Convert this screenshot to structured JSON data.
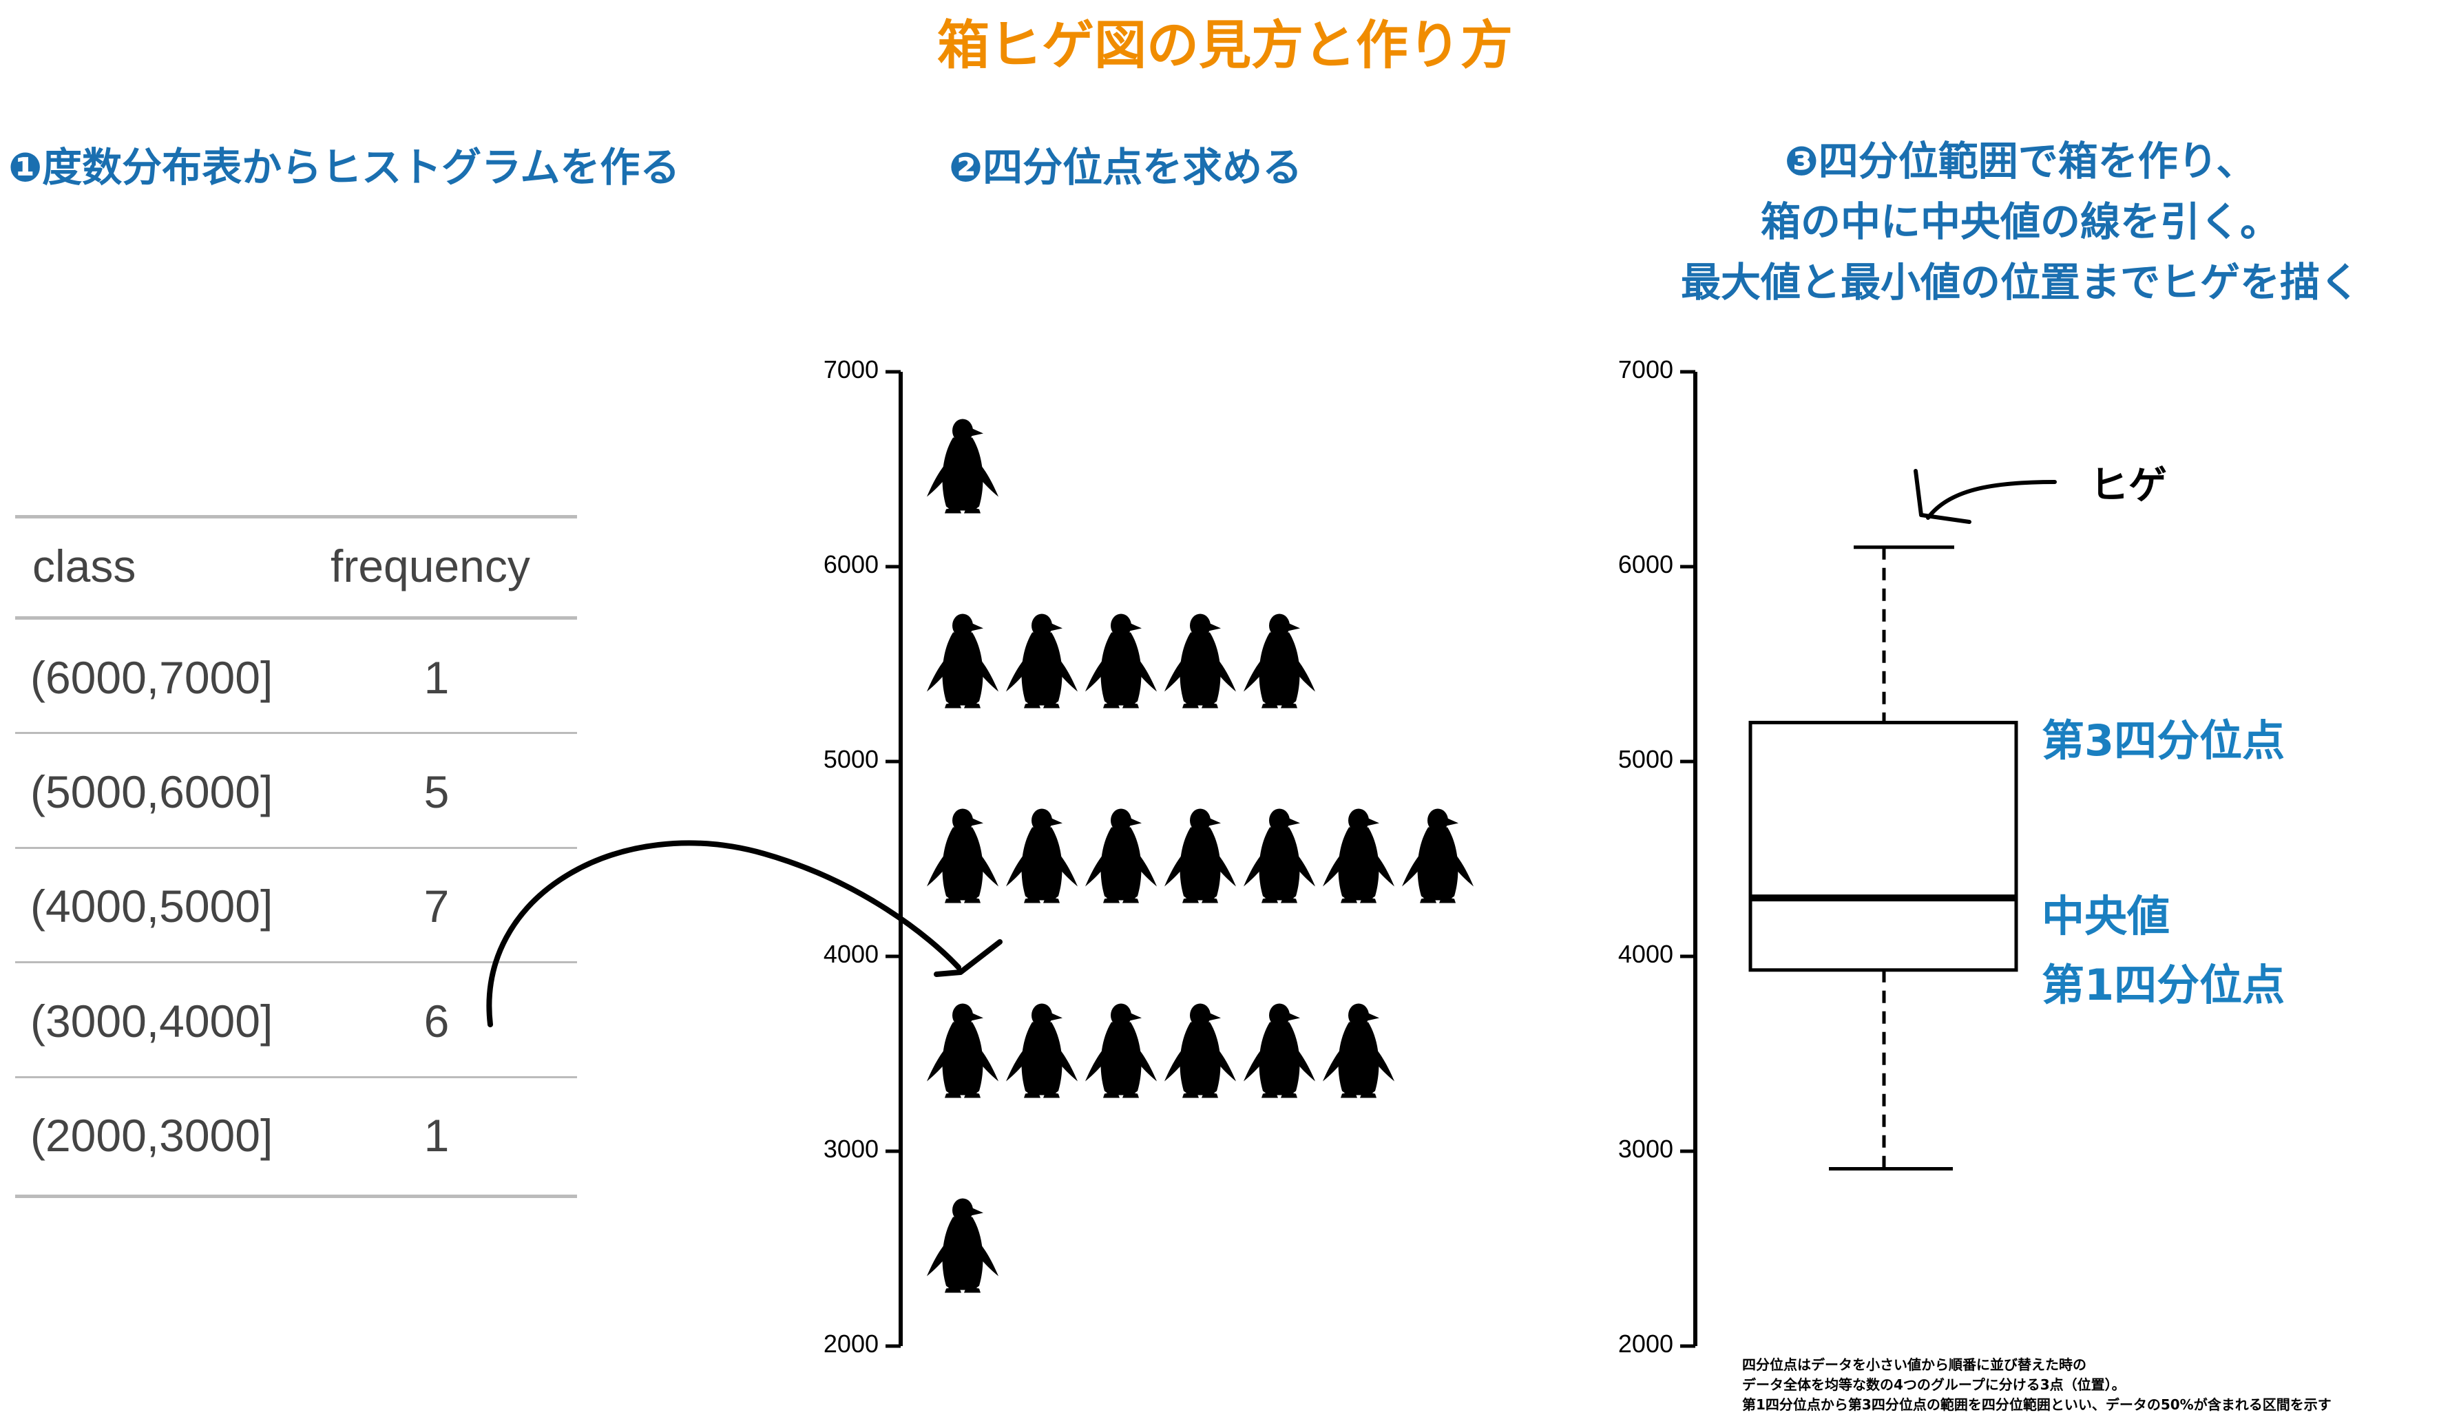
{
  "title": "箱ヒゲ図の見方と作り方",
  "colors": {
    "title": "#f08c00",
    "step": "#1a6fb0",
    "annotation": "#1a7fc0",
    "table_text": "#444444",
    "rule": "#bbbbbb"
  },
  "steps": {
    "step1": "❶度数分布表からヒストグラムを作る",
    "step2": "❷四分位点を求める",
    "step3_lines": [
      "❸四分位範囲で箱を作り、",
      "箱の中に中央値の線を引く。",
      "最大値と最小値の位置までヒゲを描く"
    ]
  },
  "table": {
    "headers": [
      "class",
      "frequency"
    ],
    "rows": [
      {
        "class": "(6000,7000]",
        "frequency": "1"
      },
      {
        "class": "(5000,6000]",
        "frequency": "5"
      },
      {
        "class": "(4000,5000]",
        "frequency": "7"
      },
      {
        "class": "(3000,4000]",
        "frequency": "6"
      },
      {
        "class": "(2000,3000]",
        "frequency": "1"
      }
    ]
  },
  "chart_data": [
    {
      "type": "pictograph",
      "icon": "penguin-icon",
      "ylim": [
        2000,
        7000
      ],
      "yticks": [
        "7000",
        "6000",
        "5000",
        "4000",
        "3000",
        "2000"
      ],
      "bins": [
        {
          "range": [
            6000,
            7000
          ],
          "count": 1
        },
        {
          "range": [
            5000,
            6000
          ],
          "count": 5
        },
        {
          "range": [
            4000,
            5000
          ],
          "count": 7
        },
        {
          "range": [
            3000,
            4000
          ],
          "count": 6
        },
        {
          "range": [
            2000,
            3000
          ],
          "count": 1
        }
      ]
    },
    {
      "type": "boxplot",
      "ylim": [
        2000,
        7000
      ],
      "yticks": [
        "7000",
        "6000",
        "5000",
        "4000",
        "3000",
        "2000"
      ],
      "whisker_max": 6100,
      "q3": 5200,
      "median": 4300,
      "q1": 3930,
      "whisker_min": 2910,
      "labels": {
        "whisker": "ヒゲ",
        "q3": "第3四分位点",
        "median": "中央値",
        "q1": "第1四分位点"
      }
    }
  ],
  "note_lines": [
    "四分位点はデータを小さい値から順番に並び替えた時の",
    "データ全体を均等な数の4つのグループに分ける3点（位置）。",
    "第1四分位点から第3四分位点の範囲を四分位範囲といい、データの50%が含まれる区間を示す"
  ]
}
